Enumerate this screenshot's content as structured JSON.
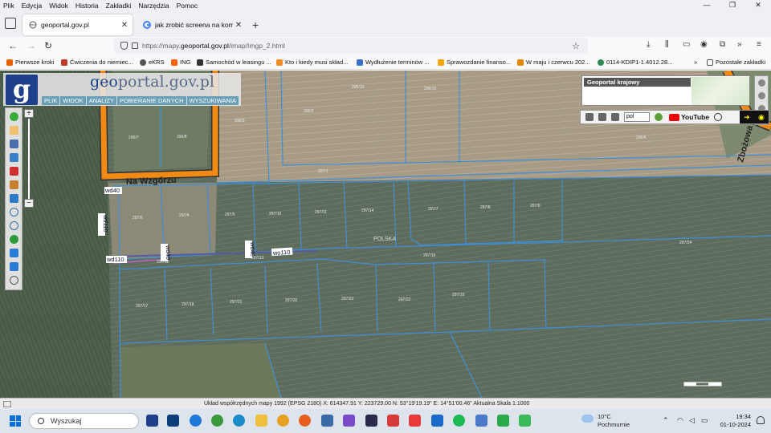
{
  "menubar": {
    "items": [
      "Plik",
      "Edycja",
      "Widok",
      "Historia",
      "Zakładki",
      "Narzędzia",
      "Pomoc"
    ],
    "window_controls": [
      "—",
      "❐",
      "✕"
    ]
  },
  "tabs": [
    {
      "title": "geoportal.gov.pl",
      "active": true
    },
    {
      "title": "jak zrobić screena na komputer",
      "active": false
    }
  ],
  "navbar": {
    "url_prefix": "https://mapy.",
    "url_domain": "geoportal.gov.pl",
    "url_suffix": "/imap/Imgp_2.html"
  },
  "bookmarks": [
    {
      "label": "Pierwsze kroki",
      "color": "#e66000"
    },
    {
      "label": "Ćwiczenia do niemiec...",
      "color": "#c0392b"
    },
    {
      "label": "eKRS",
      "color": "#555555"
    },
    {
      "label": "ING",
      "color": "#ff6200"
    },
    {
      "label": "Samochód w leasingu ...",
      "color": "#333333"
    },
    {
      "label": "Kto i kiedy musi skład...",
      "color": "#f28c28"
    },
    {
      "label": "Wydłużenie terminów ...",
      "color": "#3b6fc9"
    },
    {
      "label": "Sprawozdanie finanso...",
      "color": "#f0a500"
    },
    {
      "label": "W maju i czerwcu 202...",
      "color": "#e08a00"
    },
    {
      "label": "0114-KDIP1-1.4012.28...",
      "color": "#2e8b57"
    }
  ],
  "bookmarks_other": "Pozostałe zakładki",
  "geoportal": {
    "logo_letter": "g",
    "site_name_pre": "geo",
    "site_name_post": "portal.gov.pl",
    "menu": [
      "PLIK",
      "WIDOK",
      "ANALIZY",
      "POBIERANIE DANYCH",
      "WYSZUKIWANIA"
    ],
    "overview_label": "Geoportal krajowy",
    "language": "pol",
    "youtube_label": "YouTube"
  },
  "map": {
    "street_labels": [
      "Na Wzgórzu",
      "Zbożowa"
    ],
    "road_labels": [
      "wd40",
      "wd110",
      "wd110",
      "wd40",
      "wd40",
      "wo110"
    ],
    "country_label": "POLSKA",
    "parcel_labels": [
      "296/3",
      "295/10",
      "296/10",
      "295/2",
      "296/7",
      "296/8",
      "296/6",
      "297/1",
      "297/6",
      "297/4",
      "297/5",
      "297/10",
      "297/11",
      "297/7",
      "297/8",
      "297/9",
      "297/14",
      "297/24",
      "297/12",
      "297/13",
      "297/16",
      "297/17",
      "297/18",
      "297/21",
      "297/20",
      "297/23",
      "297/22",
      "297/19"
    ]
  },
  "statusbar": {
    "text": "Układ współrzędnych mapy 1992 (EPSG 2180)   X: 614347.91   Y: 223729.00   N: 53°19'19.19\"   E: 14°51'00.46\"   Aktualna Skala 1:1000"
  },
  "taskbar": {
    "search_placeholder": "Wyszukaj",
    "weather_temp": "10°C",
    "weather_desc": "Pochmurnie",
    "time": "19:34",
    "date": "01-10-2024"
  }
}
